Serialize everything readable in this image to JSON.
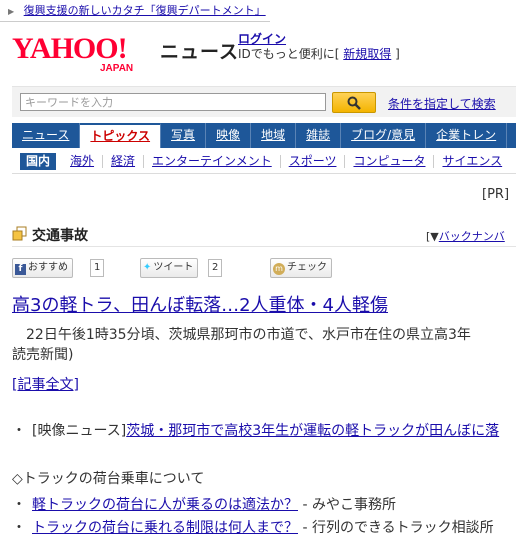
{
  "topbar": {
    "text": "復興支援の新しいカタチ「復興デパートメント」"
  },
  "logo": {
    "main": "YAHOO!",
    "sub": "JAPAN"
  },
  "header": {
    "section": "ニュース",
    "login": "ログイン",
    "login_desc": "IDでもっと便利に",
    "register": "新規取得",
    "bracket_open": "[",
    "bracket_close": "]"
  },
  "search": {
    "placeholder": "キーワードを入力",
    "conditions": "条件を指定して検索"
  },
  "tabs": [
    "ニュース",
    "トピックス",
    "写真",
    "映像",
    "地域",
    "雑誌",
    "ブログ/意見",
    "企業トレン"
  ],
  "subtabs": [
    "国内",
    "海外",
    "経済",
    "エンターテインメント",
    "スポーツ",
    "コンピュータ",
    "サイエンス"
  ],
  "pr": "[PR]",
  "topic": {
    "title": "交通事故",
    "backnumber": "バックナンバ",
    "backnumber_prefix": "[▼"
  },
  "social": {
    "recommend": "おすすめ",
    "recommend_count": "1",
    "tweet": "ツイート",
    "tweet_count": "2",
    "check": "チェック"
  },
  "article": {
    "headline": "高3の軽トラ、田んぼ転落…2人重体・4人軽傷",
    "body_line1": "22日午後1時35分頃、茨城県那珂市の市道で、水戸市在住の県立高3年",
    "body_line2": "読売新聞)",
    "fulltext": "[記事全文]"
  },
  "related": {
    "prefix": "[映像ニュース]",
    "link": "茨城・那珂市で高校3年生が運転の軽トラックが田んぼに落"
  },
  "section_title": "◇トラックの荷台乗車について",
  "items": [
    {
      "link": "軽トラックの荷台に人が乗るのは適法か？",
      "source": "- みやこ事務所"
    },
    {
      "link": "トラックの荷台に乗れる制限は何人まで？",
      "source": "- 行列のできるトラック相談所"
    }
  ],
  "colors": {
    "tab_bg": "#1e5799",
    "link": "#1a0dab",
    "logo_red": "#ff0033"
  }
}
